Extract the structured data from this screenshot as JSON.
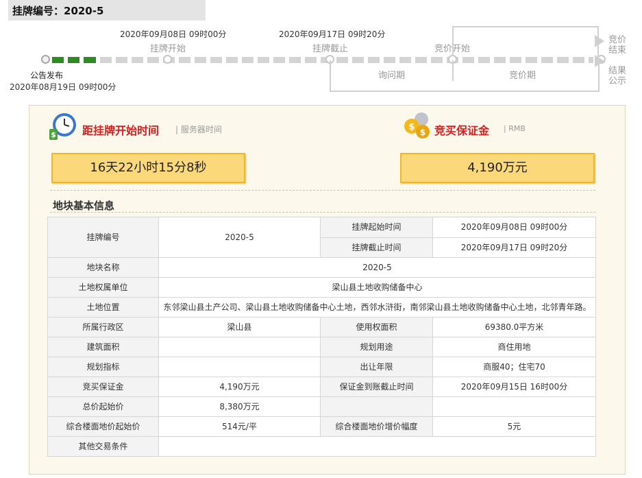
{
  "header": {
    "title": "挂牌编号：2020-5"
  },
  "timeline": {
    "stages": [
      {
        "label": "公告发布",
        "time": "2020年08月19日 09时00分"
      },
      {
        "label": "挂牌开始",
        "time": "2020年09月08日 09时00分"
      },
      {
        "label": "挂牌截止",
        "time": "2020年09月17日 09时20分"
      },
      {
        "label": "竞价开始"
      },
      {
        "label": "竞价结束"
      },
      {
        "label": "结果公示"
      }
    ],
    "periods": {
      "inquiry": "询问期",
      "bidding": "竞价期"
    },
    "end_labels": {
      "bid_end_line1": "竞价",
      "bid_end_line2": "结束",
      "result_line1": "结果",
      "result_line2": "公示"
    },
    "progress_fraction": 0.11
  },
  "countdown": {
    "title": "距挂牌开始时间",
    "sub": "服务器时间",
    "value": "16天22小时15分8秒"
  },
  "deposit": {
    "title": "竞买保证金",
    "sub": "RMB",
    "value": "4,190万元"
  },
  "section": {
    "title": "地块基本信息"
  },
  "table": {
    "r1": {
      "label": "挂牌编号",
      "value": "2020-5",
      "start_label": "挂牌起始时间",
      "start_value": "2020年09月08日 09时00分",
      "end_label": "挂牌截止时间",
      "end_value": "2020年09月17日 09时20分"
    },
    "r2": {
      "label": "地块名称",
      "value": "2020-5"
    },
    "r3": {
      "label": "土地权属单位",
      "value": "梁山县土地收购储备中心"
    },
    "r4": {
      "label": "土地位置",
      "value": "东邻梁山县土产公司、梁山县土地收购储备中心土地，西邻水浒街，南邻梁山县土地收购储备中心土地，北邻青年路。"
    },
    "r5": {
      "label": "所属行政区",
      "value": "梁山县",
      "label2": "使用权面积",
      "value2": "69380.0平方米"
    },
    "r6": {
      "label": "建筑面积",
      "value": "",
      "label2": "规划用途",
      "value2": "商住用地"
    },
    "r7": {
      "label": "规划指标",
      "value": "",
      "label2": "出让年限",
      "value2": "商服40；住宅70"
    },
    "r8": {
      "label": "竞买保证金",
      "value": "4,190万元",
      "label2": "保证金到账截止时间",
      "value2": "2020年09月15日 16时00分"
    },
    "r9": {
      "label": "总价起始价",
      "value": "8,380万元",
      "label2": "",
      "value2": ""
    },
    "r10": {
      "label": "综合楼面地价起始价",
      "value": "514元/平",
      "label2": "综合楼面地价增价幅度",
      "value2": "5元"
    },
    "r11": {
      "label": "其他交易条件",
      "value": ""
    }
  },
  "colors": {
    "accent_red": "#d41f1f",
    "progress_green": "#2e8b22",
    "box_yellow": "#fbd87a",
    "panel_bg": "#fcf9ec"
  }
}
